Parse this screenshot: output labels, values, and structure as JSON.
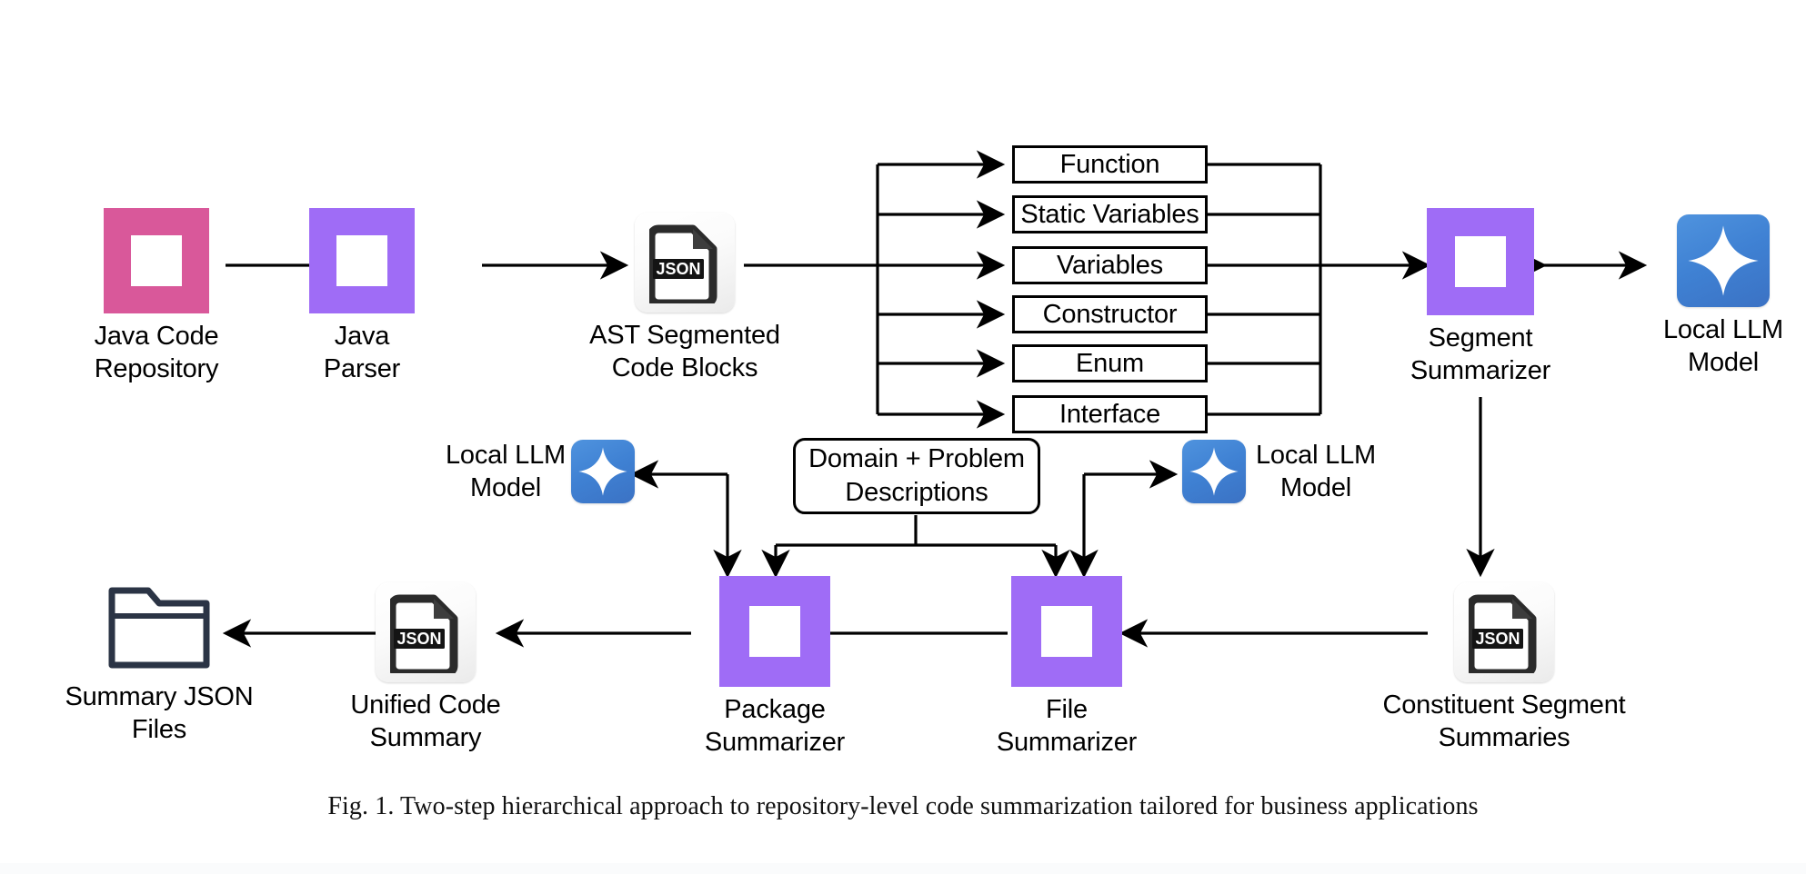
{
  "figure": {
    "caption": "Fig. 1.  Two-step hierarchical approach to repository-level code summarization tailored for business applications"
  },
  "colors": {
    "pink": "#d9589a",
    "purple": "#9f6cf6",
    "llm_blue": "#3f81d3",
    "stroke": "#000000",
    "folder_stroke": "#2b3445",
    "background": "#ffffff"
  },
  "pipeline": {
    "stage_java_repo": {
      "label": "Java Code\nRepository",
      "icon": "pink-square-frame-icon"
    },
    "stage_java_parser": {
      "label": "Java\nParser",
      "icon": "purple-square-frame-icon"
    },
    "stage_ast_blocks": {
      "label": "AST Segmented\nCode Blocks",
      "icon": "json-file-icon",
      "icon_text": "JSON"
    },
    "stage_segment_summarizer": {
      "label": "Segment\nSummarizer",
      "icon": "purple-square-frame-icon"
    },
    "stage_llm_top_right": {
      "label": "Local LLM\nModel",
      "icon": "sparkle-icon"
    },
    "stage_constituent_summaries": {
      "label": "Constituent Segment\nSummaries",
      "icon": "json-file-icon",
      "icon_text": "JSON"
    },
    "stage_file_summarizer": {
      "label": "File\nSummarizer",
      "icon": "purple-square-frame-icon"
    },
    "stage_llm_file": {
      "label": "Local LLM\nModel",
      "icon": "sparkle-icon"
    },
    "stage_package_summarizer": {
      "label": "Package\nSummarizer",
      "icon": "purple-square-frame-icon"
    },
    "stage_llm_package": {
      "label": "Local LLM\nModel",
      "icon": "sparkle-icon"
    },
    "stage_unified_summary": {
      "label": "Unified Code\nSummary",
      "icon": "json-file-icon",
      "icon_text": "JSON"
    },
    "stage_summary_files": {
      "label": "Summary JSON\nFiles",
      "icon": "folder-icon"
    },
    "stage_domain_problem": {
      "label": "Domain + Problem\nDescriptions"
    }
  },
  "ast_categories": [
    {
      "label": "Function"
    },
    {
      "label": "Static Variables"
    },
    {
      "label": "Variables"
    },
    {
      "label": "Constructor"
    },
    {
      "label": "Enum"
    },
    {
      "label": "Interface"
    }
  ]
}
